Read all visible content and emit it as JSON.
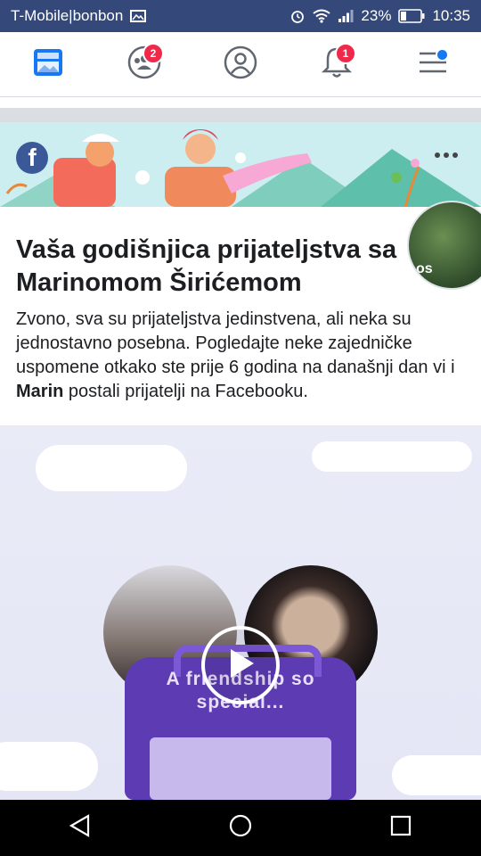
{
  "status_bar": {
    "carrier": "T-Mobile|bonbon",
    "battery": "23%",
    "time": "10:35"
  },
  "nav": {
    "items": [
      {
        "name": "news-feed-icon",
        "badge": ""
      },
      {
        "name": "friends-icon",
        "badge": "2"
      },
      {
        "name": "profile-icon",
        "badge": ""
      },
      {
        "name": "notifications-icon",
        "badge": "1"
      },
      {
        "name": "menu-icon",
        "badge": ""
      }
    ]
  },
  "card": {
    "logo_letter": "f",
    "game_thumb_text": "os",
    "title": "Vaša godišnjica prijateljstva sa Marinomom Širićemom",
    "description_before": "Zvono, sva su prijateljstva jedinstvena, ali neka su jednostavno posebna. Pogledajte neke zajedničke uspomene otkako ste prije 6 godina na današnji dan vi i ",
    "description_name": "Marin",
    "description_after": " postali prijatelji na Facebooku.",
    "video_line1": "A friendship so",
    "video_line2": "special..."
  },
  "colors": {
    "status_bg": "#34497a",
    "badge": "#f02849",
    "fb_blue": "#1877f2",
    "suitcase": "#5c3bb3"
  }
}
